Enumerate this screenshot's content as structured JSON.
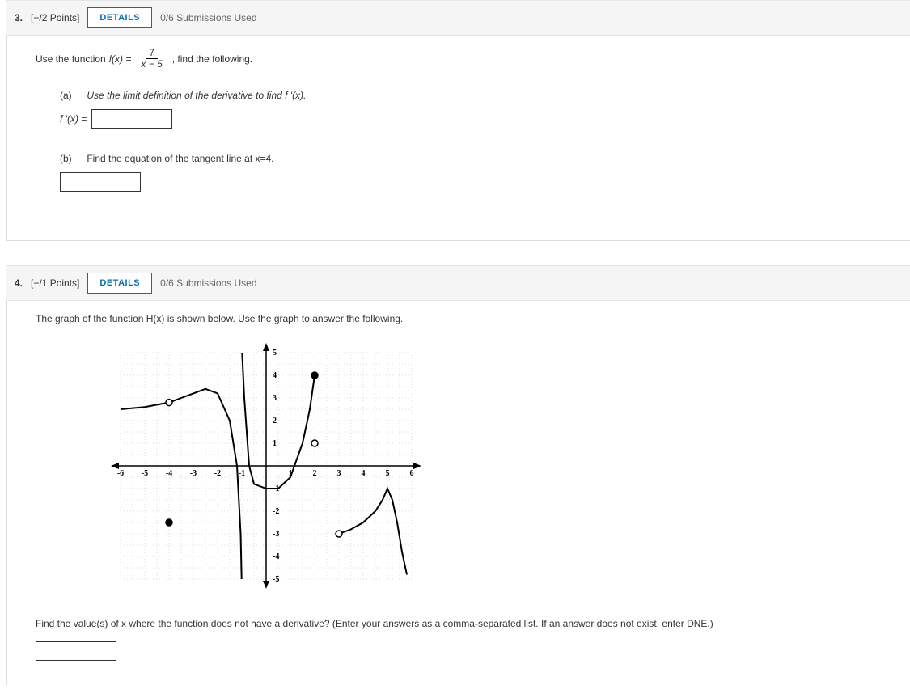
{
  "q3": {
    "number": "3.",
    "points": "[−/2 Points]",
    "details": "DETAILS",
    "submissions": "0/6 Submissions Used",
    "prompt_pre": "Use the function ",
    "func_lhs": "f(x) = ",
    "frac_num": "7",
    "frac_den": "x − 5",
    "prompt_post": ", find the following.",
    "a_label": "(a)",
    "a_text": "Use the limit definition of the derivative to find f '(x).",
    "a_answer_label": "f '(x) =",
    "b_label": "(b)",
    "b_text": "Find the equation of the tangent line at x=4."
  },
  "q4": {
    "number": "4.",
    "points": "[−/1 Points]",
    "details": "DETAILS",
    "submissions": "0/6 Submissions Used",
    "prompt": "The graph of the function H(x) is shown below. Use the graph to answer the following.",
    "followup": "Find the value(s) of x where the function does not have a derivative? (Enter your answers as a comma-separated list. If an answer does not exist, enter DNE.)"
  },
  "chart_data": {
    "type": "line",
    "xlim": [
      -6,
      6
    ],
    "ylim": [
      -5,
      5
    ],
    "xticks": [
      -6,
      -5,
      -4,
      -3,
      -2,
      -1,
      1,
      2,
      3,
      4,
      5,
      6
    ],
    "yticks": [
      -5,
      -4,
      -3,
      -2,
      -1,
      1,
      2,
      3,
      4,
      5
    ],
    "segments": [
      {
        "name": "left-branch",
        "points": [
          [
            -6,
            2.5
          ],
          [
            -5.5,
            2.55
          ],
          [
            -5,
            2.6
          ],
          [
            -4.5,
            2.7
          ],
          [
            -4,
            2.8
          ],
          [
            -3.5,
            3.0
          ],
          [
            -3,
            3.2
          ],
          [
            -2.5,
            3.4
          ],
          [
            -2,
            3.2
          ],
          [
            -1.5,
            2.0
          ],
          [
            -1.2,
            0
          ],
          [
            -1.05,
            -3
          ],
          [
            -1.01,
            -5
          ]
        ]
      },
      {
        "name": "middle-branch",
        "points": [
          [
            -0.99,
            5
          ],
          [
            -0.9,
            3
          ],
          [
            -0.7,
            0
          ],
          [
            -0.5,
            -0.8
          ],
          [
            0,
            -1
          ],
          [
            0.5,
            -1
          ],
          [
            1,
            -0.5
          ],
          [
            1.5,
            1
          ],
          [
            1.8,
            2.5
          ],
          [
            2,
            4
          ]
        ]
      },
      {
        "name": "right-branch",
        "points": [
          [
            3,
            -3
          ],
          [
            3.5,
            -2.8
          ],
          [
            4,
            -2.5
          ],
          [
            4.5,
            -2
          ],
          [
            4.8,
            -1.5
          ],
          [
            5,
            -1
          ],
          [
            5.2,
            -1.5
          ],
          [
            5.4,
            -2.5
          ],
          [
            5.6,
            -3.8
          ],
          [
            5.8,
            -4.8
          ]
        ]
      }
    ],
    "points": [
      {
        "x": -4,
        "y": 2.8,
        "type": "open"
      },
      {
        "x": -4,
        "y": -2.5,
        "type": "closed"
      },
      {
        "x": 2,
        "y": 4,
        "type": "closed"
      },
      {
        "x": 2,
        "y": 1,
        "type": "open"
      },
      {
        "x": 3,
        "y": -3,
        "type": "open"
      }
    ]
  }
}
